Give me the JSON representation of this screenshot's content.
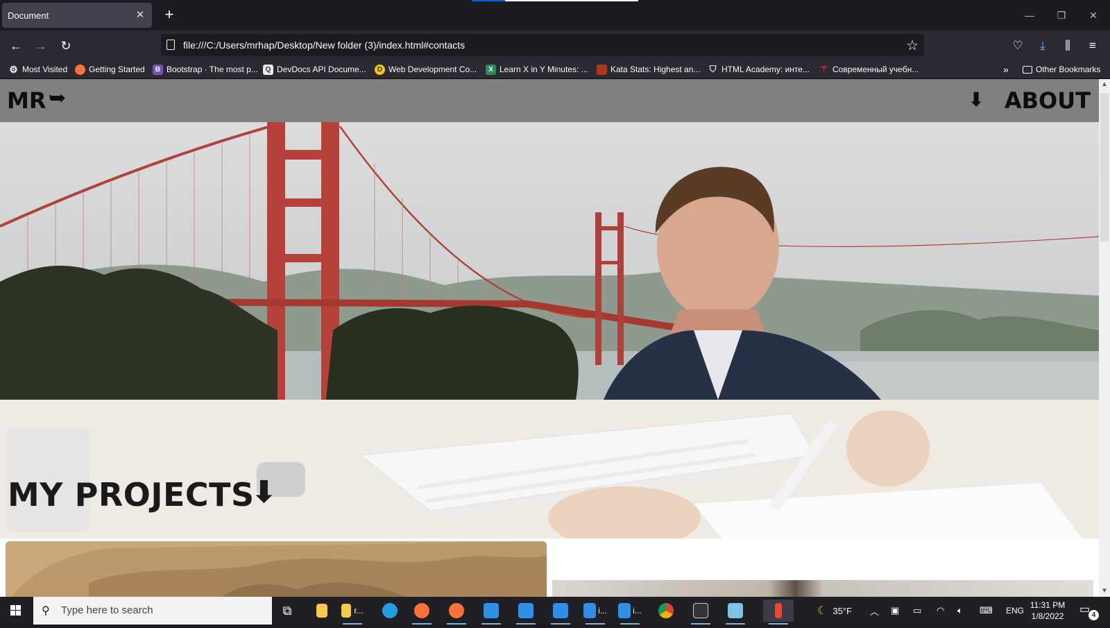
{
  "browser": {
    "tab_title": "Document",
    "url": "file:///C:/Users/mrhap/Desktop/New folder (3)/index.html#contacts",
    "bookmarks": [
      {
        "label": "Most Visited",
        "icon": "gear-icon",
        "color": "#fbfbfe"
      },
      {
        "label": "Getting Started",
        "icon": "firefox-icon",
        "color": "#ff7139"
      },
      {
        "label": "Bootstrap · The most p...",
        "icon": "bootstrap-icon",
        "color": "#7952b3"
      },
      {
        "label": "DevDocs API Docume...",
        "icon": "devdocs-icon",
        "color": "#e8e8e8"
      },
      {
        "label": "Web Development Co...",
        "icon": "webdev-icon",
        "color": "#f5c518"
      },
      {
        "label": "Learn X in Y Minutes: ...",
        "icon": "learnx-icon",
        "color": "#2e8b57"
      },
      {
        "label": "Kata Stats: Highest an...",
        "icon": "codewars-icon",
        "color": "#b1361e"
      },
      {
        "label": "HTML Academy: инте...",
        "icon": "shield-icon",
        "color": "#e8e8e8"
      },
      {
        "label": "Современный учебн...",
        "icon": "jsinfo-icon",
        "color": "#d4281f"
      }
    ],
    "other_bookmarks": "Other Bookmarks"
  },
  "site": {
    "logo": "MR",
    "logo_arrow": "➥",
    "about_link": "ABOUT",
    "about_arrow": "⬇",
    "projects_title": "MY PROJECTS",
    "projects_arrow": "⬇"
  },
  "taskbar": {
    "search_placeholder": "Type here to search",
    "apps": [
      {
        "name": "task-view-icon",
        "color": "#ffffff"
      },
      {
        "name": "file-explorer-icon",
        "color": "#f7c948"
      },
      {
        "name": "file-explorer-icon",
        "color": "#f7c948",
        "label": "r..."
      },
      {
        "name": "edge-icon",
        "color": "#1fa0e3"
      },
      {
        "name": "firefox-icon",
        "color": "#ff7139"
      },
      {
        "name": "firefox-icon",
        "color": "#ff7139"
      },
      {
        "name": "vscode-icon",
        "color": "#2f8fe8"
      },
      {
        "name": "vscode-icon",
        "color": "#2f8fe8"
      },
      {
        "name": "vscode-icon",
        "color": "#2f8fe8"
      },
      {
        "name": "vscode-icon",
        "color": "#2f8fe8",
        "label": "i..."
      },
      {
        "name": "vscode-icon",
        "color": "#2f8fe8",
        "label": "i..."
      },
      {
        "name": "chrome-icon",
        "color": "#e8b61c"
      },
      {
        "name": "terminal-icon",
        "color": "#cccccc"
      },
      {
        "name": "notepad-icon",
        "color": "#7fc4e6"
      },
      {
        "name": "paint-icon",
        "color": "#e8482f"
      }
    ],
    "weather": "35°F",
    "language": "ENG",
    "time": "11:31 PM",
    "date": "1/8/2022",
    "notification_count": "4"
  }
}
